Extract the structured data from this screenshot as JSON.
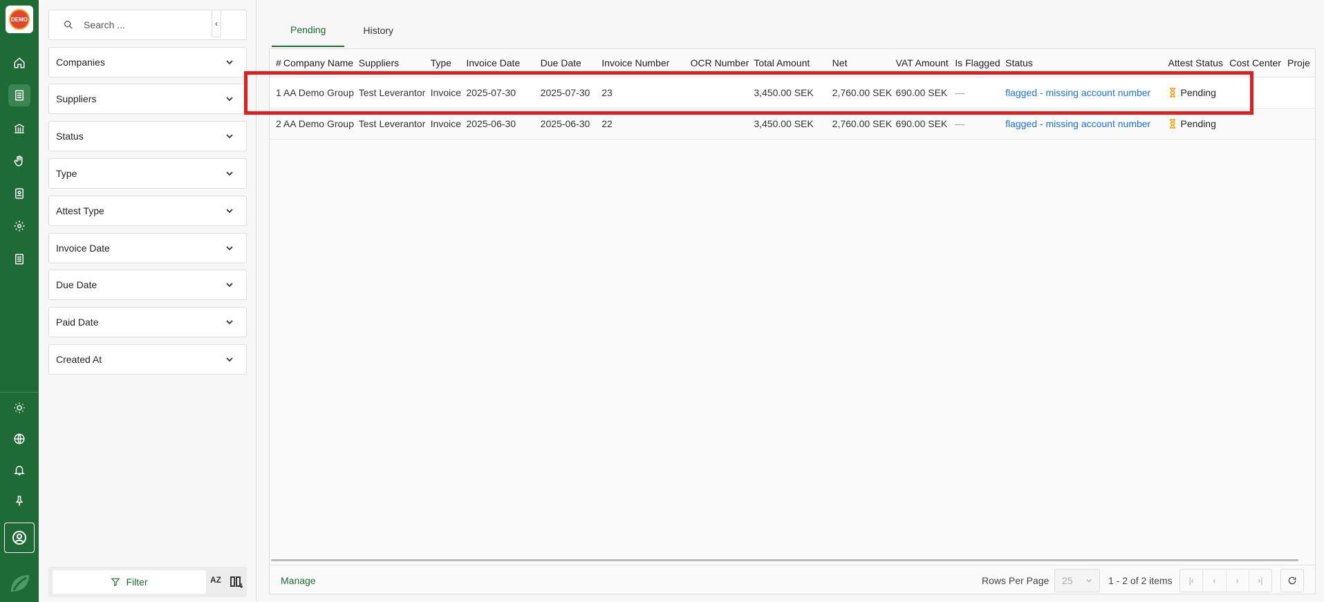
{
  "brand": {
    "logo_text": "DEMO",
    "accent": "#1e6b35",
    "highlight": "#e11d1d"
  },
  "rail": {
    "icons": [
      "home-icon",
      "invoice-icon",
      "bank-icon",
      "hand-icon",
      "contacts-icon",
      "settings-icon",
      "document-icon",
      "theme-icon",
      "globe-icon",
      "bell-icon",
      "pin-icon",
      "profile-icon",
      "leaf-logo-icon"
    ]
  },
  "sidebar": {
    "search_placeholder": "Search ...",
    "facets": [
      "Companies",
      "Suppliers",
      "Status",
      "Type",
      "Attest Type",
      "Invoice Date",
      "Due Date",
      "Paid Date",
      "Created At"
    ],
    "filter_label": "Filter",
    "sort_label": "AZ"
  },
  "tabs": [
    "Pending",
    "History"
  ],
  "table": {
    "columns": [
      "#",
      "Company Name",
      "Suppliers",
      "Type",
      "Invoice Date",
      "Due Date",
      "Invoice Number",
      "OCR Number",
      "Total Amount",
      "Net",
      "VAT Amount",
      "Is Flagged",
      "Status",
      "Attest Status",
      "Cost Center",
      "Proje"
    ],
    "rows": [
      [
        "1",
        "AA Demo Group",
        "Test Leverantor",
        "Invoice",
        "2025-07-30",
        "2025-07-30",
        "23",
        "",
        "3,450.00 SEK",
        "2,760.00 SEK",
        "690.00 SEK",
        "—",
        "flagged - missing account number",
        "Pending",
        "",
        ""
      ],
      [
        "2",
        "AA Demo Group",
        "Test Leverantor",
        "Invoice",
        "2025-06-30",
        "2025-06-30",
        "22",
        "",
        "3,450.00 SEK",
        "2,760.00 SEK",
        "690.00 SEK",
        "—",
        "flagged - missing account number",
        "Pending",
        "",
        ""
      ]
    ]
  },
  "footer": {
    "manage_label": "Manage",
    "rows_per_page_label": "Rows Per Page",
    "rows_per_page_value": "25",
    "range_text": "1 - 2 of 2 items"
  }
}
